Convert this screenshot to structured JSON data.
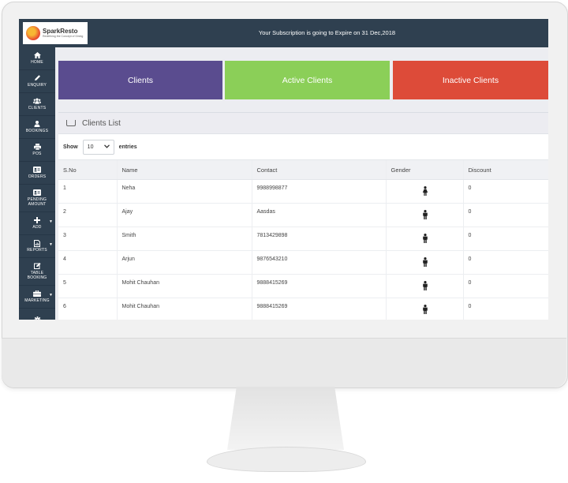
{
  "app": {
    "logo_name": "SparkResto",
    "logo_tagline": "Redefining the Concept of Dining",
    "subscription_message": "Your Subscription is going to Expire on 31 Dec,2018"
  },
  "sidebar": {
    "items": [
      {
        "label": "HOME",
        "icon": "home-icon"
      },
      {
        "label": "ENQUIRY",
        "icon": "pencil-icon"
      },
      {
        "label": "CLIENTS",
        "icon": "users-icon"
      },
      {
        "label": "BOOKINGS",
        "icon": "user-icon"
      },
      {
        "label": "POS",
        "icon": "printer-icon"
      },
      {
        "label": "ORDERS",
        "icon": "id-card-icon"
      },
      {
        "label": "PENDING",
        "label2": "AMOUNT",
        "icon": "id-card-icon"
      },
      {
        "label": "ADD",
        "icon": "plus-icon"
      },
      {
        "label": "REPORTS",
        "icon": "report-icon"
      },
      {
        "label": "TABLE",
        "label2": "BOOKING",
        "icon": "edit-icon"
      },
      {
        "label": "MARKETING",
        "icon": "briefcase-icon"
      },
      {
        "label": "",
        "icon": "gear-icon"
      }
    ]
  },
  "tiles": [
    {
      "label": "Clients",
      "color": "#5a4c8f"
    },
    {
      "label": "Active Clients",
      "color": "#8bcf58"
    },
    {
      "label": "Inactive Clients",
      "color": "#dd4b39"
    }
  ],
  "panel": {
    "title": "Clients List",
    "show_label": "Show",
    "entries_label": "entries",
    "page_size": "10"
  },
  "table": {
    "columns": [
      "S.No",
      "Name",
      "Contact",
      "Gender",
      "Discount"
    ],
    "rows": [
      {
        "sno": "1",
        "name": "Neha",
        "contact": "9988998877",
        "gender": "female",
        "discount": "0"
      },
      {
        "sno": "2",
        "name": "Ajay",
        "contact": "Aasdas",
        "gender": "male",
        "discount": "0"
      },
      {
        "sno": "3",
        "name": "Smith",
        "contact": "7813429898",
        "gender": "male",
        "discount": "0"
      },
      {
        "sno": "4",
        "name": "Arjun",
        "contact": "9876543210",
        "gender": "male",
        "discount": "0"
      },
      {
        "sno": "5",
        "name": "Mohit Chauhan",
        "contact": "9888415269",
        "gender": "male",
        "discount": "0"
      },
      {
        "sno": "6",
        "name": "Mohit Chauhan",
        "contact": "9888415269",
        "gender": "male",
        "discount": "0"
      }
    ]
  }
}
